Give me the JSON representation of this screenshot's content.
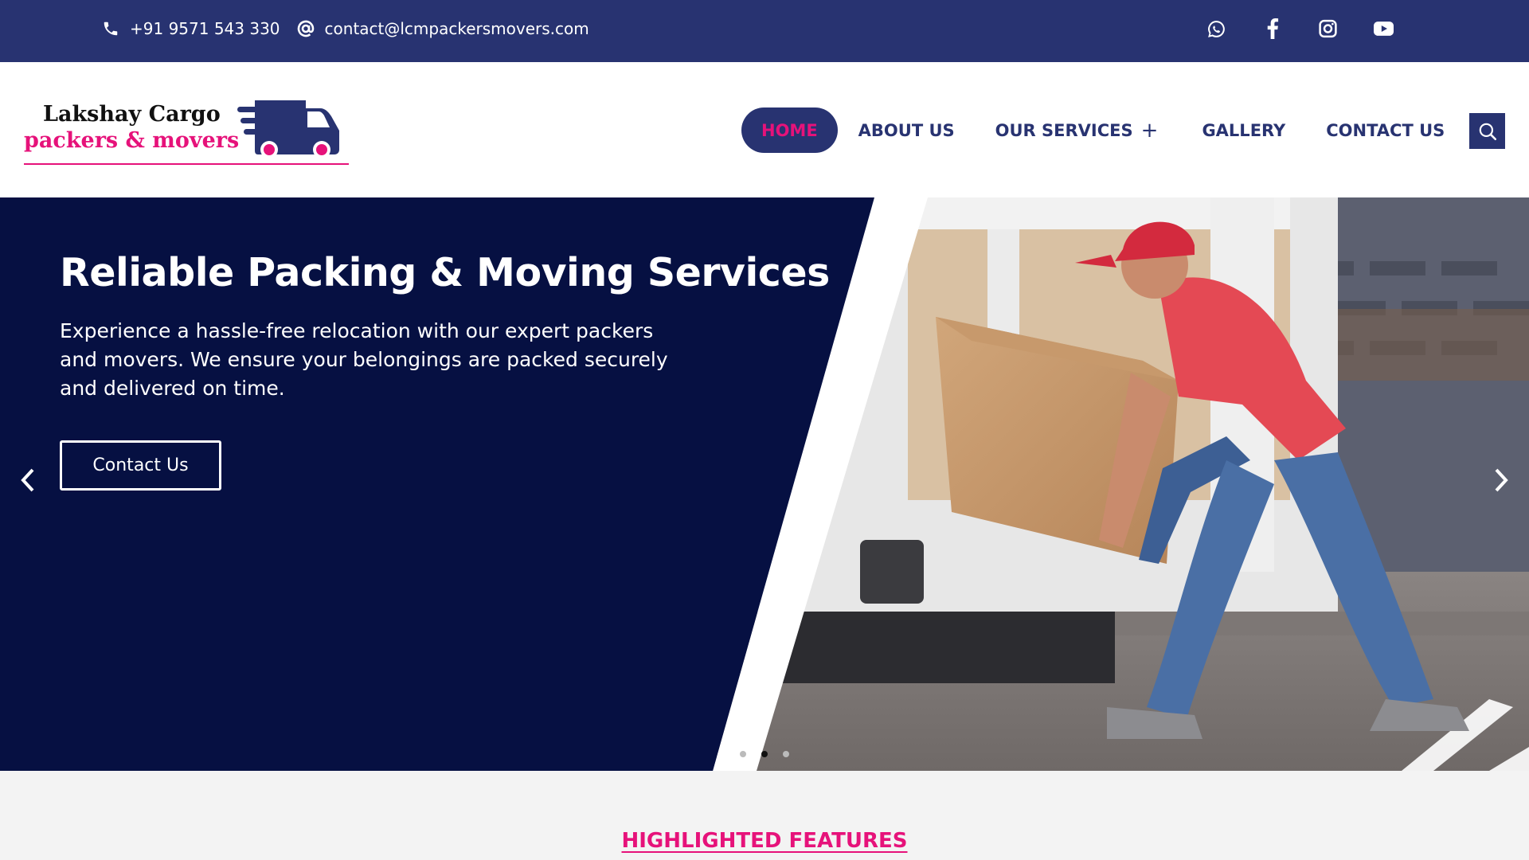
{
  "topbar": {
    "phone": "+91 9571 543 330",
    "email": "contact@lcmpackersmovers.com",
    "social": [
      "whatsapp-icon",
      "facebook-icon",
      "instagram-icon",
      "youtube-icon"
    ]
  },
  "logo": {
    "line1": "Lakshay Cargo",
    "line2": "packers & movers"
  },
  "nav": {
    "home": "HOME",
    "about": "ABOUT US",
    "services": "OUR SERVICES",
    "services_expand": "+",
    "gallery": "GALLERY",
    "contact": "CONTACT US"
  },
  "hero": {
    "title": "Reliable Packing & Moving Services",
    "text": "Experience a hassle-free relocation with our expert packers and movers. We ensure your belongings are packed securely and delivered on time.",
    "button": "Contact Us",
    "slide_count": 3,
    "active_slide": 2
  },
  "features": {
    "title": "HIGHLIGHTED FEATURES"
  },
  "colors": {
    "brand_navy": "#283371",
    "hero_navy": "#061042",
    "accent_pink": "#e6127a"
  }
}
